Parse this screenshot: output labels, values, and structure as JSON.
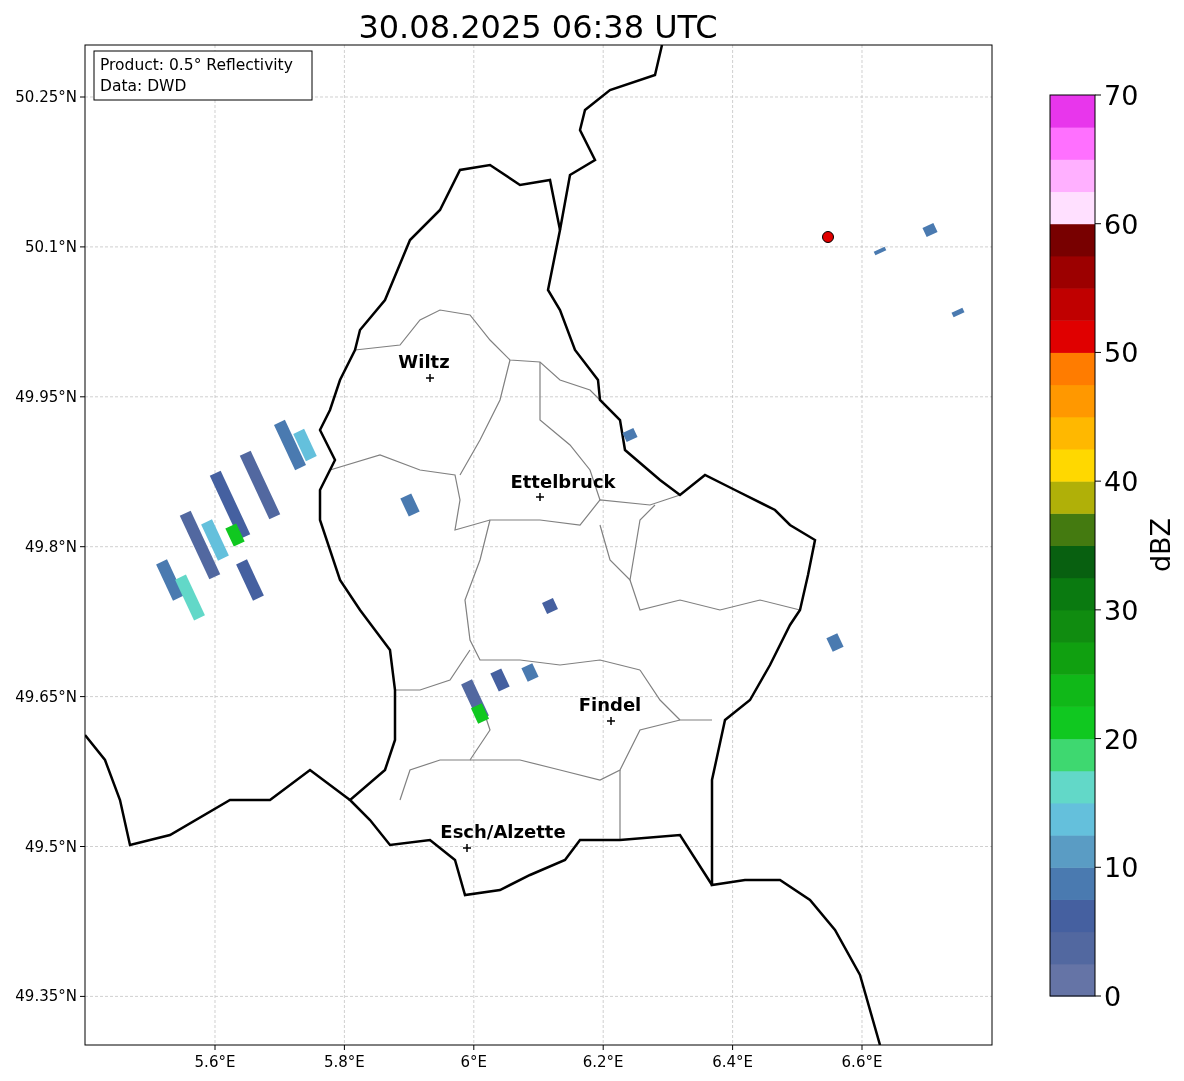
{
  "title": "30.08.2025 06:38 UTC",
  "info_box": {
    "lines": [
      "Product: 0.5° Reflectivity",
      "Data: DWD"
    ]
  },
  "map": {
    "lon_ticks": [
      "5.6°E",
      "5.8°E",
      "6°E",
      "6.2°E",
      "6.4°E",
      "6.6°E"
    ],
    "lat_ticks": [
      "50.25°N",
      "50.1°N",
      "49.95°N",
      "49.8°N",
      "49.65°N",
      "49.5°N",
      "49.35°N"
    ],
    "cities": [
      {
        "name": "Wiltz"
      },
      {
        "name": "Ettelbruck"
      },
      {
        "name": "Findel"
      },
      {
        "name": "Esch/Alzette"
      }
    ]
  },
  "colorbar": {
    "label": "dBZ",
    "ticks": [
      "70",
      "60",
      "50",
      "40",
      "30",
      "20",
      "10",
      "0"
    ],
    "bands": [
      {
        "color": "#6574a6"
      },
      {
        "color": "#5268a0"
      },
      {
        "color": "#4560a0"
      },
      {
        "color": "#4a7ab0"
      },
      {
        "color": "#5a9cc4"
      },
      {
        "color": "#64c0dc"
      },
      {
        "color": "#62d8c8"
      },
      {
        "color": "#3ed870"
      },
      {
        "color": "#10c820"
      },
      {
        "color": "#10b818"
      },
      {
        "color": "#10a010"
      },
      {
        "color": "#108c10"
      },
      {
        "color": "#0a7a10"
      },
      {
        "color": "#086010"
      },
      {
        "color": "#447a10"
      },
      {
        "color": "#b0b008"
      },
      {
        "color": "#ffd800"
      },
      {
        "color": "#ffb800"
      },
      {
        "color": "#ff9800"
      },
      {
        "color": "#ff7c00"
      },
      {
        "color": "#e00000"
      },
      {
        "color": "#c00000"
      },
      {
        "color": "#9c0000"
      },
      {
        "color": "#780000"
      },
      {
        "color": "#ffe0ff"
      },
      {
        "color": "#ffb0ff"
      },
      {
        "color": "#ff70ff"
      },
      {
        "color": "#e836ec"
      }
    ]
  }
}
